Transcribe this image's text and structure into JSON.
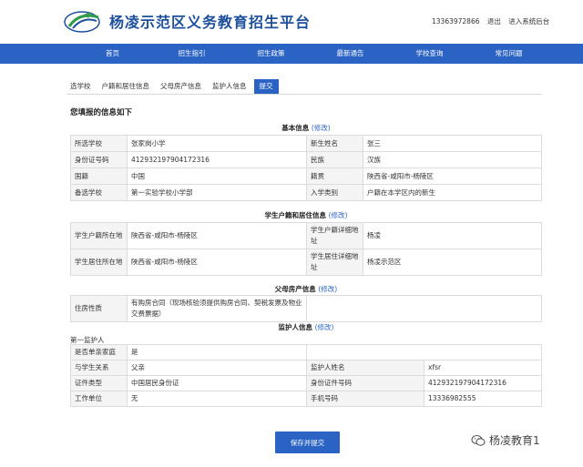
{
  "header": {
    "site_title": "杨凌示范区义务教育招生平台",
    "phone": "13363972866",
    "logout": "退出",
    "admin": "进入系统后台"
  },
  "nav": [
    "首页",
    "招生指引",
    "招生政策",
    "最新通告",
    "学校查询",
    "常见问题"
  ],
  "tabs": [
    "选学校",
    "户籍和居住信息",
    "父母房产信息",
    "监护人信息",
    "提交"
  ],
  "active_tab": "提交",
  "intro": "您填报的信息如下",
  "edit_label": "(修改)",
  "sections": {
    "basic": {
      "title": "基本信息",
      "rows": [
        [
          "所选学校",
          "张家岗小学",
          "新生姓名",
          "张三"
        ],
        [
          "身份证号码",
          "412932197904172316",
          "民族",
          "汉族"
        ],
        [
          "国籍",
          "中国",
          "籍贯",
          "陕西省-咸阳市-杨陵区"
        ],
        [
          "备选学校",
          "第一实验学校小学部",
          "入学类别",
          "户籍在本学区内的新生"
        ]
      ]
    },
    "residence": {
      "title": "学生户籍和居住信息",
      "rows": [
        [
          "学生户籍所在地",
          "陕西省-咸阳市-杨陵区",
          "学生户籍详细地址",
          "杨凌"
        ],
        [
          "学生居住所在地",
          "陕西省-咸阳市-杨陵区",
          "学生居住详细地址",
          "杨凌示范区"
        ]
      ]
    },
    "property": {
      "title": "父母房产信息",
      "rows": [
        [
          "住房性质",
          "有购房合同（现场核验须提供购房合同、契税发票及物业交费票据）"
        ]
      ]
    },
    "guardian": {
      "title": "监护人信息",
      "sub_label": "第一监护人",
      "rows": [
        [
          "是否单亲家庭",
          "是",
          "",
          ""
        ],
        [
          "与学生关系",
          "父亲",
          "监护人姓名",
          "xfsr"
        ],
        [
          "证件类型",
          "中国居民身份证",
          "身份证件号码",
          "412932197904172316"
        ],
        [
          "工作单位",
          "无",
          "手机号码",
          "13336982555"
        ]
      ]
    }
  },
  "submit_label": "保存并提交",
  "watermark": "杨凌教育1"
}
